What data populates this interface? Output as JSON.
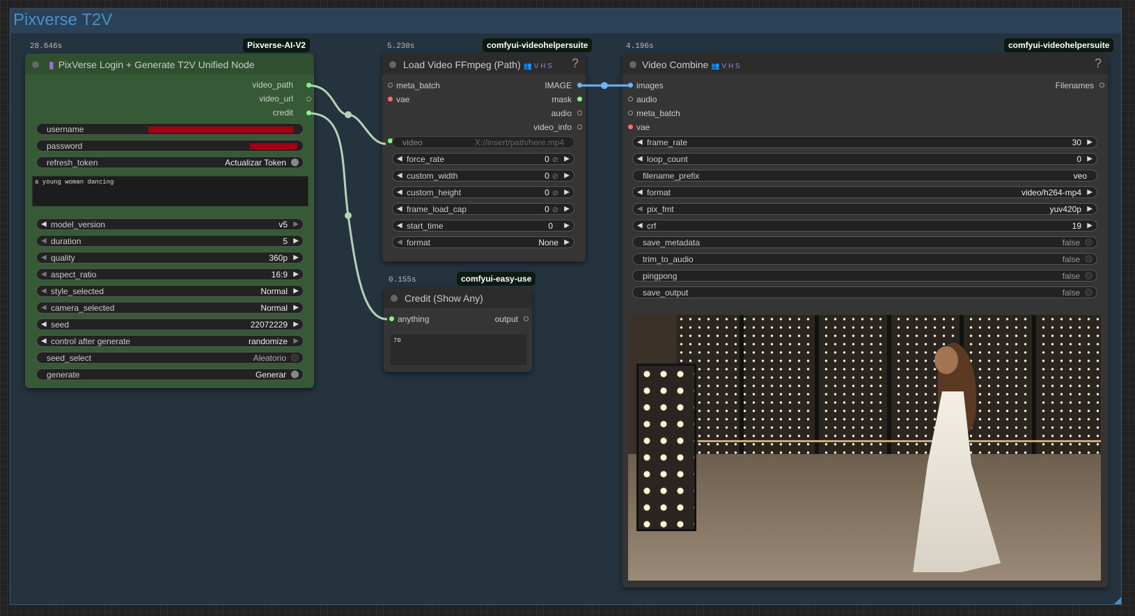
{
  "group": {
    "title": "Pixverse T2V"
  },
  "nodes": {
    "pixverse": {
      "time": "28.646s",
      "badge": "Pixverse-AI-V2",
      "title": "PixVerse Login + Generate T2V Unified Node",
      "outputs": [
        "video_path",
        "video_url",
        "credit"
      ],
      "username_label": "username",
      "password_label": "password",
      "refresh_token_label": "refresh_token",
      "refresh_token_value": "Actualizar Token",
      "prompt": "a young woman dancing",
      "widgets": [
        {
          "label": "model_version",
          "value": "v5"
        },
        {
          "label": "duration",
          "value": "5"
        },
        {
          "label": "quality",
          "value": "360p"
        },
        {
          "label": "aspect_ratio",
          "value": "16:9"
        },
        {
          "label": "style_selected",
          "value": "Normal"
        },
        {
          "label": "camera_selected",
          "value": "Normal"
        },
        {
          "label": "seed",
          "value": "22072229"
        },
        {
          "label": "control after generate",
          "value": "randomize"
        }
      ],
      "seed_select_label": "seed_select",
      "seed_select_value": "Aleatorio",
      "generate_label": "generate",
      "generate_value": "Generar"
    },
    "loadvideo": {
      "time": "5.230s",
      "badge": "comfyui-videohelpersuite",
      "title": "Load Video FFmpeg (Path)",
      "title_icons": "👥 V H S",
      "help": "?",
      "inputs": [
        "meta_batch",
        "vae"
      ],
      "outputs": [
        "IMAGE",
        "mask",
        "audio",
        "video_info"
      ],
      "video_label": "video",
      "video_placeholder": "X://insert/path/here.mp4",
      "widgets": [
        {
          "label": "force_rate",
          "value": "0"
        },
        {
          "label": "custom_width",
          "value": "0"
        },
        {
          "label": "custom_height",
          "value": "0"
        },
        {
          "label": "frame_load_cap",
          "value": "0"
        },
        {
          "label": "start_time",
          "value": "0"
        },
        {
          "label": "format",
          "value": "None"
        }
      ],
      "null_glyph": "⊘"
    },
    "credit": {
      "time": "0.155s",
      "badge": "comfyui-easy-use",
      "title": "Credit (Show Any)",
      "input": "anything",
      "output": "output",
      "value": "70"
    },
    "videocombine": {
      "time": "4.196s",
      "badge": "comfyui-videohelpersuite",
      "title": "Video Combine",
      "title_icons": "👥 V H S",
      "help": "?",
      "inputs": [
        "images",
        "audio",
        "meta_batch",
        "vae"
      ],
      "output": "Filenames",
      "widgets": [
        {
          "label": "frame_rate",
          "value": "30"
        },
        {
          "label": "loop_count",
          "value": "0"
        },
        {
          "label": "filename_prefix",
          "value": "veo"
        },
        {
          "label": "format",
          "value": "video/h264-mp4"
        },
        {
          "label": "pix_fmt",
          "value": "yuv420p"
        },
        {
          "label": "crf",
          "value": "19"
        }
      ],
      "toggles": [
        {
          "label": "save_metadata",
          "value": "false"
        },
        {
          "label": "trim_to_audio",
          "value": "false"
        },
        {
          "label": "pingpong",
          "value": "false"
        },
        {
          "label": "save_output",
          "value": "false"
        }
      ]
    }
  },
  "colors": {
    "group_bg": "#25333f",
    "pixverse_node": "#355a35",
    "node_dark": "#353535",
    "link": "#b5d3b5",
    "image_link": "#6ab4ff"
  }
}
